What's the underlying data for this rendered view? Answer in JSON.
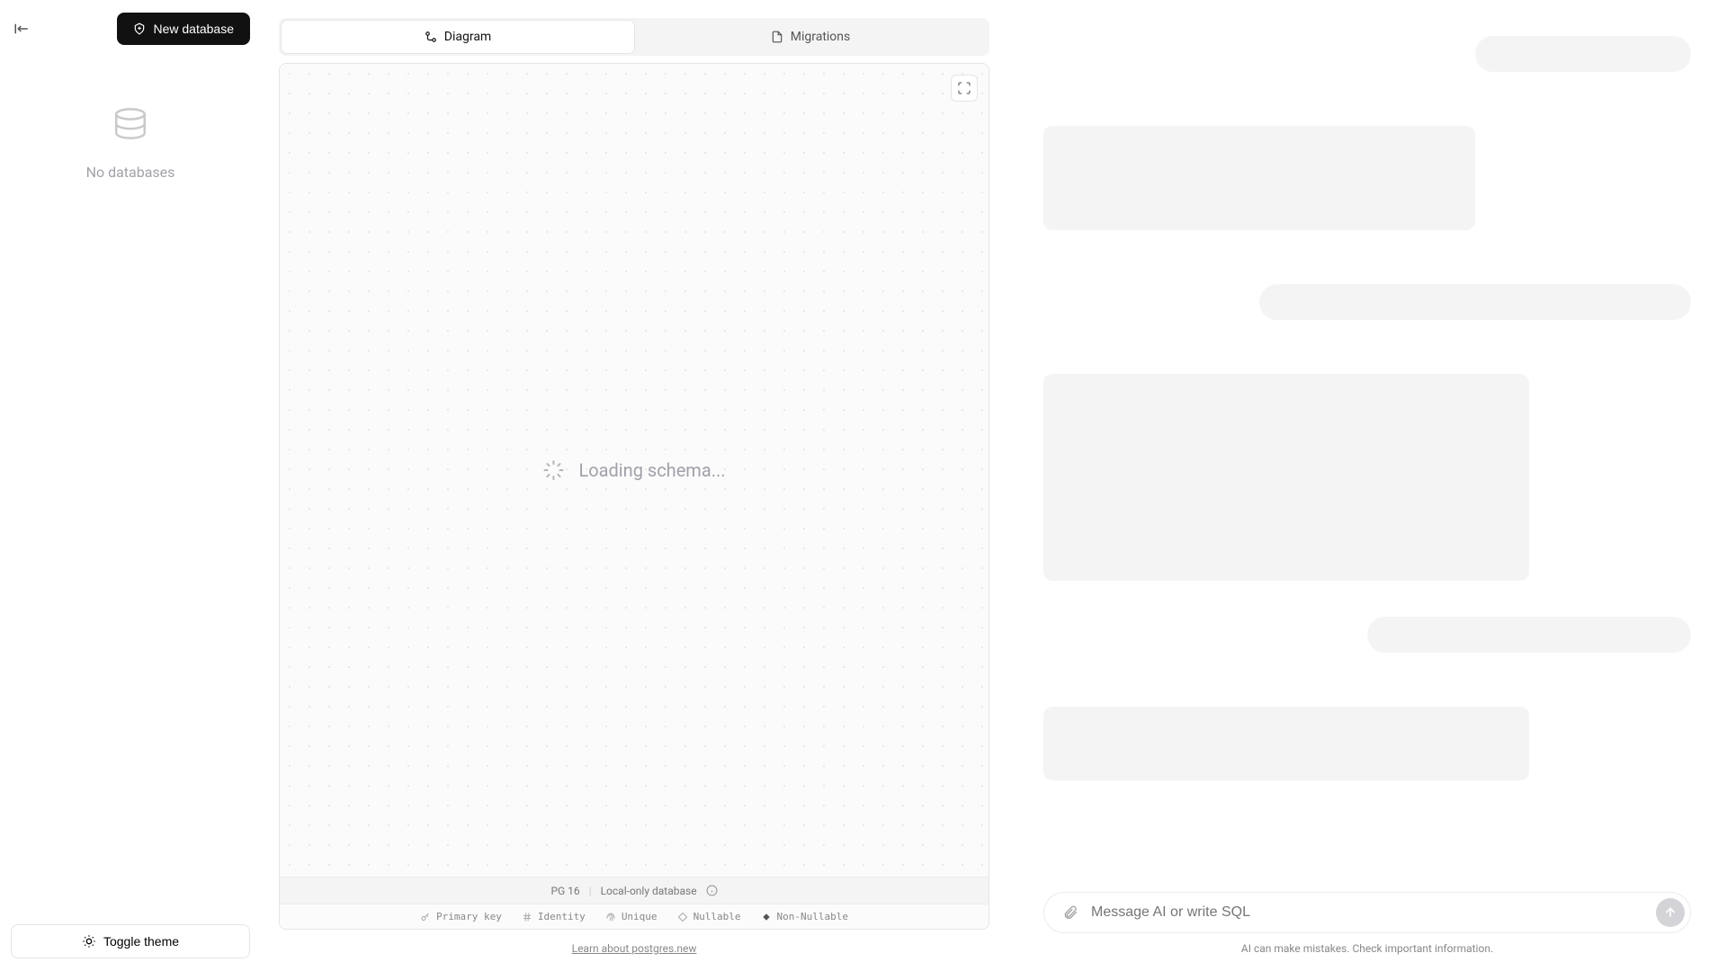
{
  "sidebar": {
    "new_database_label": "New database",
    "empty_state_text": "No databases",
    "toggle_theme_label": "Toggle theme"
  },
  "tabs": {
    "diagram_label": "Diagram",
    "migrations_label": "Migrations",
    "active": "diagram"
  },
  "canvas": {
    "loading_text": "Loading schema..."
  },
  "status": {
    "pg_version": "PG 16",
    "local_db_label": "Local-only database"
  },
  "legend": {
    "primary_key": "Primary key",
    "identity": "Identity",
    "unique": "Unique",
    "nullable": "Nullable",
    "non_nullable": "Non-Nullable"
  },
  "learn_link": "Learn about postgres.new",
  "chat": {
    "input_placeholder": "Message AI or write SQL",
    "disclaimer": "AI can make mistakes. Check important information."
  }
}
